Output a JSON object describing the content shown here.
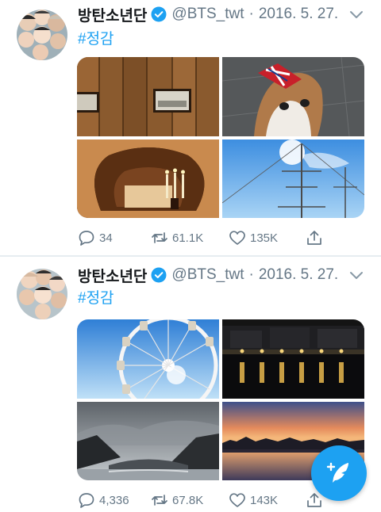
{
  "tweets": [
    {
      "display_name": "방탄소년단",
      "handle": "@BTS_twt",
      "separator": "·",
      "date": "2016. 5. 27.",
      "hashtag": "#정감",
      "replies": "34",
      "retweets": "61.1K",
      "likes": "135K"
    },
    {
      "display_name": "방탄소년단",
      "handle": "@BTS_twt",
      "separator": "·",
      "date": "2016. 5. 27.",
      "hashtag": "#정감",
      "replies": "4,336",
      "retweets": "67.8K",
      "likes": "143K"
    }
  ],
  "icons": {
    "verified": "verified-badge-icon",
    "menu": "chevron-down-icon",
    "reply": "reply-icon",
    "retweet": "retweet-icon",
    "like": "heart-icon",
    "share": "share-icon",
    "compose": "compose-tweet-icon"
  },
  "colors": {
    "accent": "#1da1f2",
    "text_primary": "#14171a",
    "text_secondary": "#657786",
    "divider": "#e6ecf0"
  }
}
